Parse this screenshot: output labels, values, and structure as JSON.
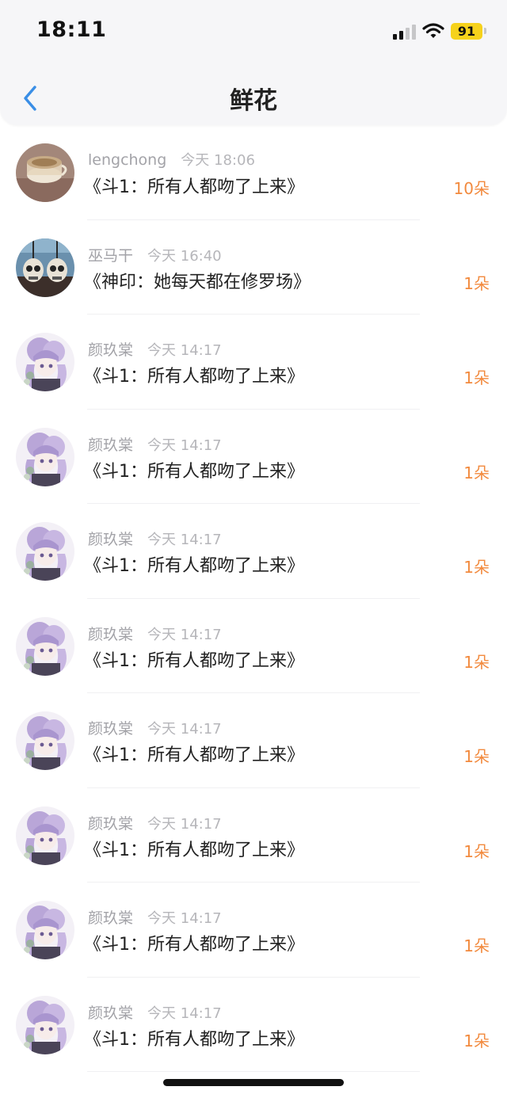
{
  "status_bar": {
    "time": "18:11",
    "battery": "91"
  },
  "header": {
    "title": "鲜花"
  },
  "colors": {
    "accent_back": "#3a8ee6",
    "flower_count": "#f28a3e",
    "battery": "#f6d21b"
  },
  "items": [
    {
      "user": "lengchong",
      "time": "今天 18:06",
      "book": "《斗1：所有人都吻了上来》",
      "count": "10朵",
      "avatar": "cup"
    },
    {
      "user": "巫马干",
      "time": "今天 16:40",
      "book": "《神印：她每天都在修罗场》",
      "count": "1朵",
      "avatar": "skulls"
    },
    {
      "user": "颜玖棠",
      "time": "今天 14:17",
      "book": "《斗1：所有人都吻了上来》",
      "count": "1朵",
      "avatar": "anime"
    },
    {
      "user": "颜玖棠",
      "time": "今天 14:17",
      "book": "《斗1：所有人都吻了上来》",
      "count": "1朵",
      "avatar": "anime"
    },
    {
      "user": "颜玖棠",
      "time": "今天 14:17",
      "book": "《斗1：所有人都吻了上来》",
      "count": "1朵",
      "avatar": "anime"
    },
    {
      "user": "颜玖棠",
      "time": "今天 14:17",
      "book": "《斗1：所有人都吻了上来》",
      "count": "1朵",
      "avatar": "anime"
    },
    {
      "user": "颜玖棠",
      "time": "今天 14:17",
      "book": "《斗1：所有人都吻了上来》",
      "count": "1朵",
      "avatar": "anime"
    },
    {
      "user": "颜玖棠",
      "time": "今天 14:17",
      "book": "《斗1：所有人都吻了上来》",
      "count": "1朵",
      "avatar": "anime"
    },
    {
      "user": "颜玖棠",
      "time": "今天 14:17",
      "book": "《斗1：所有人都吻了上来》",
      "count": "1朵",
      "avatar": "anime"
    },
    {
      "user": "颜玖棠",
      "time": "今天 14:17",
      "book": "《斗1：所有人都吻了上来》",
      "count": "1朵",
      "avatar": "anime"
    }
  ]
}
